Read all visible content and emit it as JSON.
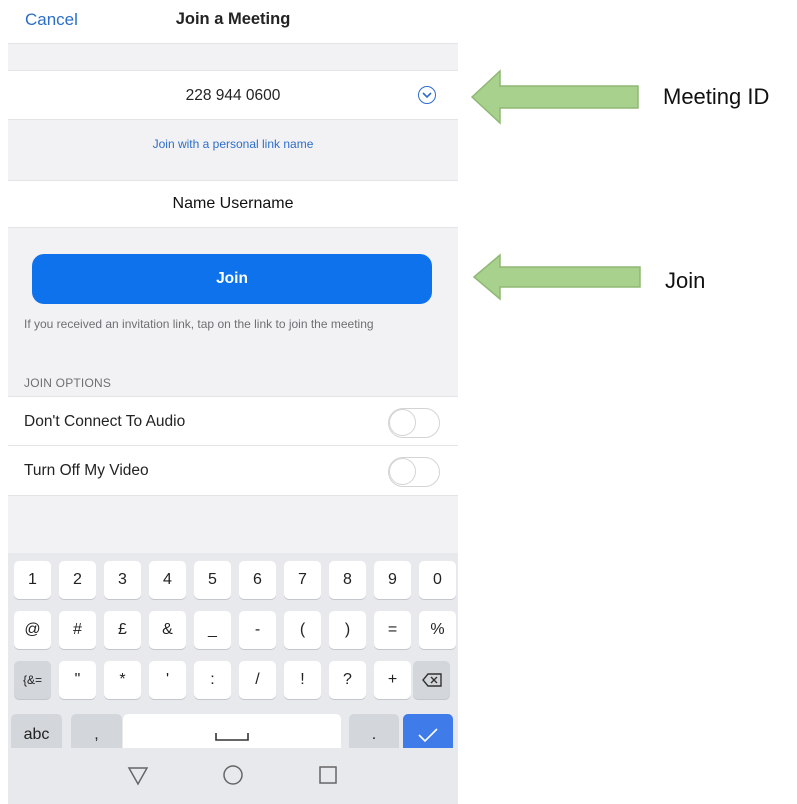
{
  "nav": {
    "cancel_label": "Cancel",
    "title": "Join a Meeting"
  },
  "meeting_id": {
    "value": "228 944 0600",
    "expand_icon": "chevron-down-circle-icon"
  },
  "personal_link_label": "Join with a personal link name",
  "name_field": {
    "value": "Name Username"
  },
  "join_button_label": "Join",
  "hint_text": "If you received an invitation link, tap on the link to join the meeting",
  "join_options": {
    "header": "JOIN OPTIONS",
    "options": [
      {
        "label": "Don't Connect To Audio",
        "enabled": false
      },
      {
        "label": "Turn Off My Video",
        "enabled": false
      }
    ]
  },
  "keyboard": {
    "row1": [
      "1",
      "2",
      "3",
      "4",
      "5",
      "6",
      "7",
      "8",
      "9",
      "0"
    ],
    "row2": [
      "@",
      "#",
      "£",
      "&",
      "_",
      "-",
      "(",
      ")",
      "=",
      "%"
    ],
    "row3": [
      "{&=",
      "\"",
      "*",
      "'",
      ":",
      "/",
      "!",
      "?",
      "+"
    ],
    "backspace_icon": "backspace-icon",
    "abc_label": "abc",
    "comma_label": ",",
    "space_icon": "spacebar-icon",
    "period_label": ".",
    "confirm_icon": "checkmark-icon"
  },
  "system_nav": {
    "back_icon": "triangle-back-icon",
    "home_icon": "circle-home-icon",
    "recent_icon": "square-recent-icon"
  },
  "annotations": [
    {
      "label": "Meeting ID",
      "arrow_color": "#a9d18e"
    },
    {
      "label": "Join",
      "arrow_color": "#a9d18e"
    }
  ],
  "colors": {
    "accent_blue": "#0e72ed",
    "link_blue": "#2d6ec9",
    "annotation_green": "#a9d18e"
  }
}
